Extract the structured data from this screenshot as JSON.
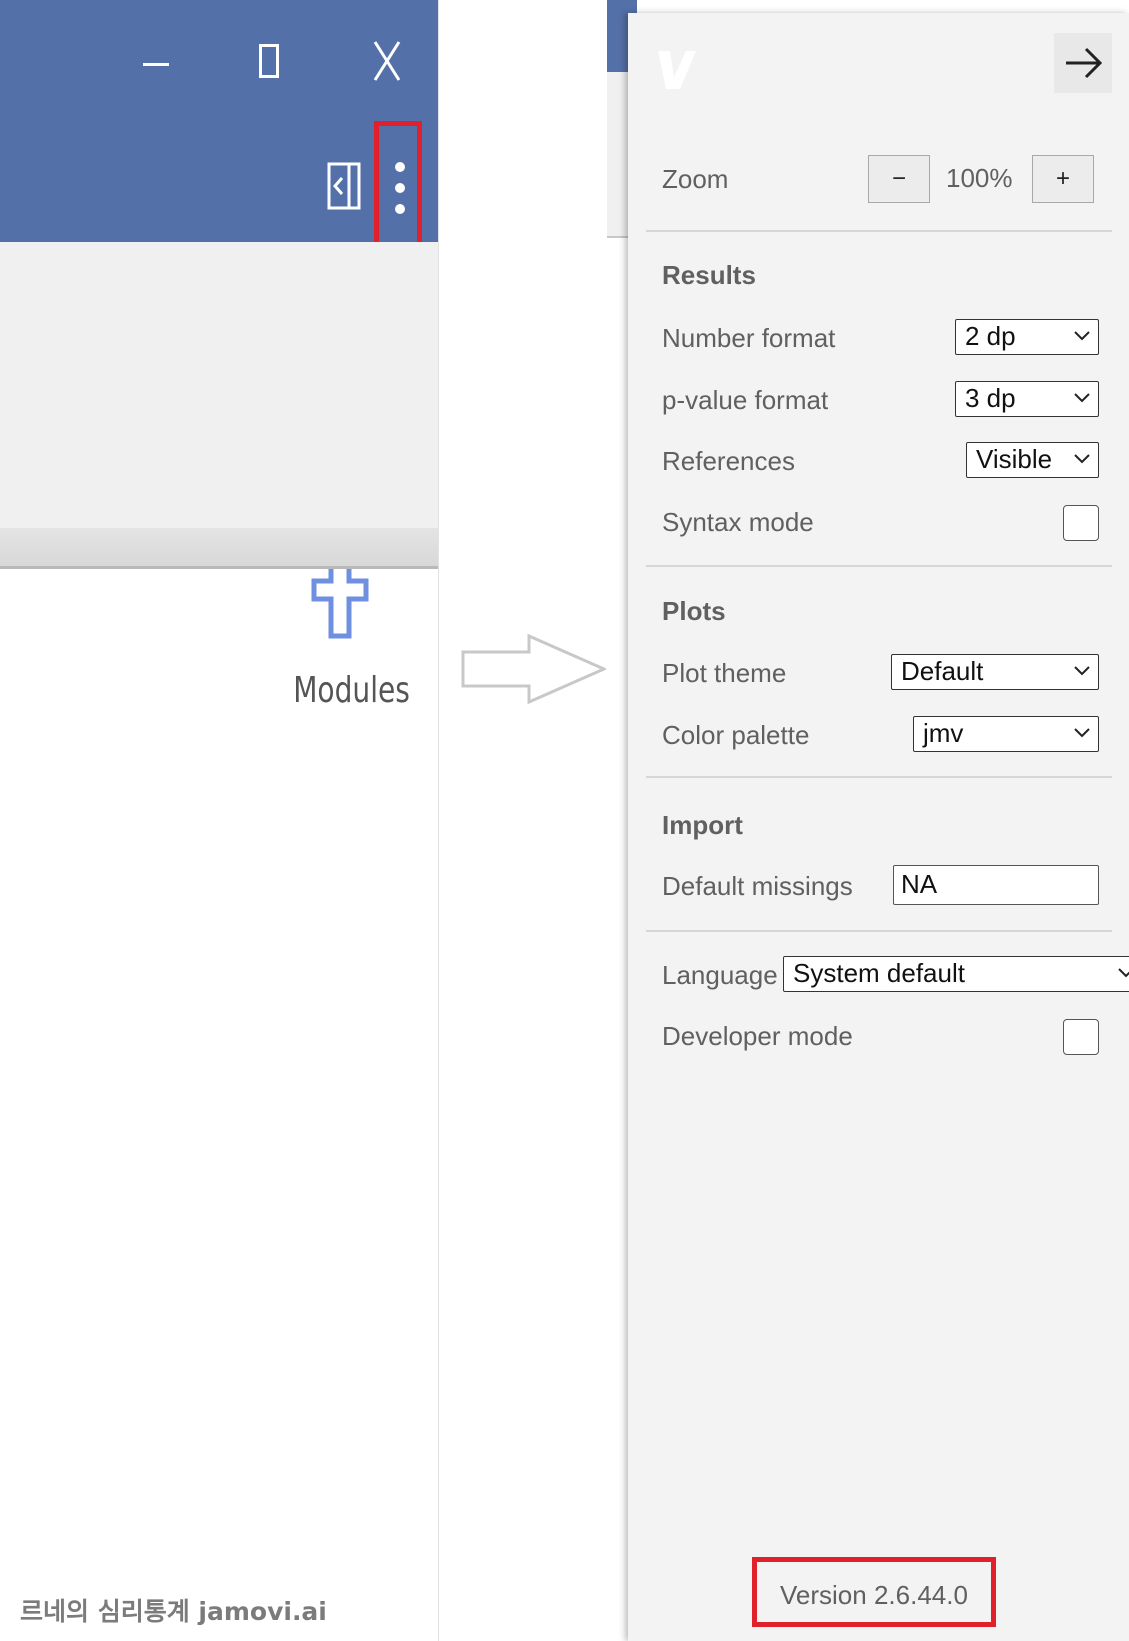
{
  "left_window": {
    "ribbon": {
      "modules_label": "Modules"
    },
    "watermark": "르네의 심리통계 jamovi.ai"
  },
  "settings": {
    "zoom": {
      "label": "Zoom",
      "minus": "−",
      "value": "100%",
      "plus": "+"
    },
    "results": {
      "title": "Results",
      "number_format": {
        "label": "Number format",
        "value": "2 dp"
      },
      "p_value_format": {
        "label": "p-value format",
        "value": "3 dp"
      },
      "references": {
        "label": "References",
        "value": "Visible"
      },
      "syntax_mode": {
        "label": "Syntax mode",
        "checked": false
      }
    },
    "plots": {
      "title": "Plots",
      "plot_theme": {
        "label": "Plot theme",
        "value": "Default"
      },
      "color_palette": {
        "label": "Color palette",
        "value": "jmv"
      }
    },
    "import": {
      "title": "Import",
      "default_missings": {
        "label": "Default missings",
        "value": "NA"
      }
    },
    "language": {
      "label": "Language",
      "value": "System default"
    },
    "developer_mode": {
      "label": "Developer mode",
      "checked": false
    },
    "version": "Version 2.6.44.0"
  },
  "colors": {
    "titlebar": "#5470a8",
    "highlight": "#e0202a",
    "modules_icon": "#6f8fe0"
  }
}
